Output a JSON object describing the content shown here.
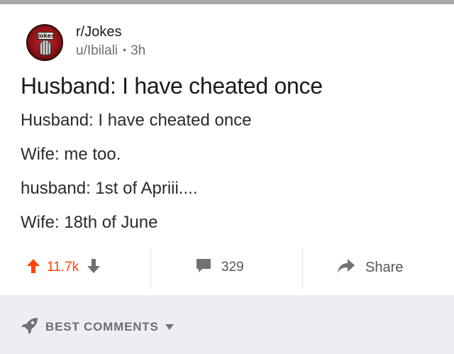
{
  "post": {
    "subreddit": "r/Jokes",
    "author": "u/Ibilali",
    "age": "3h",
    "avatar_badge_text": "Jokes",
    "title": "Husband: I have cheated once",
    "body_lines": [
      "Husband: I have cheated once",
      "Wife: me too.",
      "husband: 1st of Apriii....",
      "Wife: 18th of June"
    ]
  },
  "actions": {
    "upvote_count": "11.7k",
    "comment_count": "329",
    "share_label": "Share"
  },
  "sort": {
    "label": "BEST COMMENTS"
  },
  "colors": {
    "upvote_accent": "#ff4500",
    "icon_gray": "#6f7275",
    "sort_bar_bg": "#eceef1"
  }
}
